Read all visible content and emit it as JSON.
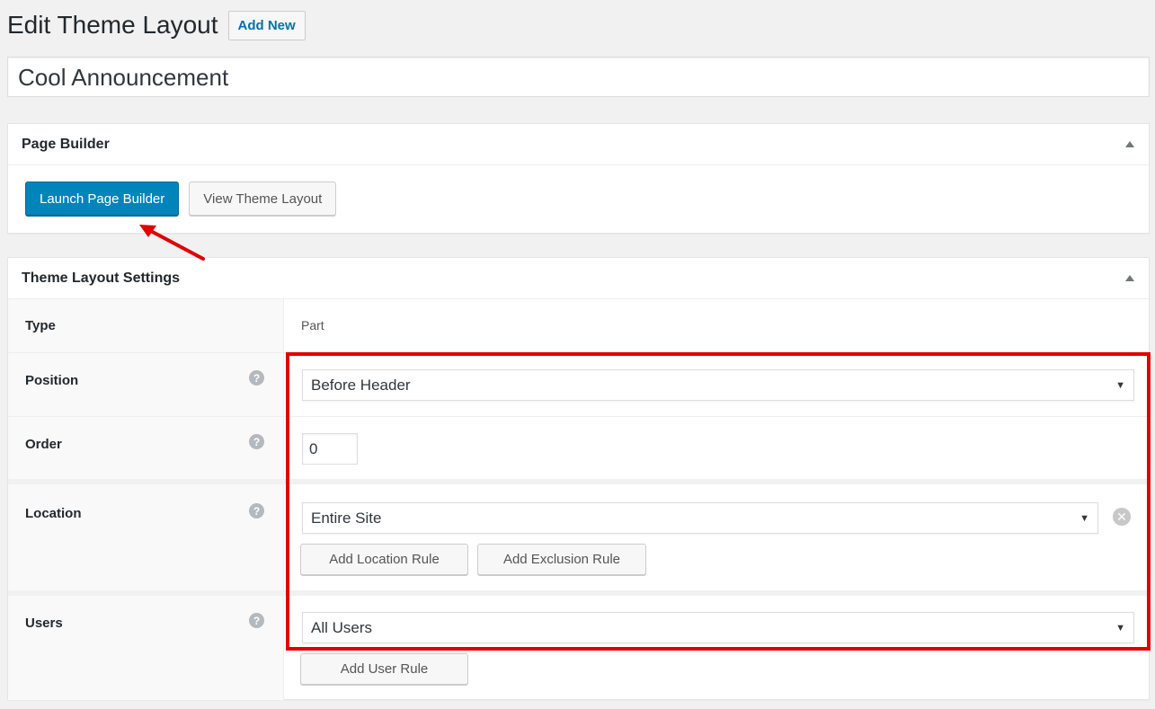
{
  "header": {
    "title": "Edit Theme Layout",
    "add_new_label": "Add New"
  },
  "post_title": "Cool Announcement",
  "page_builder_box": {
    "title": "Page Builder",
    "launch_label": "Launch Page Builder",
    "view_label": "View Theme Layout"
  },
  "settings_box": {
    "title": "Theme Layout Settings",
    "rows": {
      "type": {
        "label": "Type",
        "value": "Part"
      },
      "position": {
        "label": "Position",
        "value": "Before Header"
      },
      "order": {
        "label": "Order",
        "value": "0"
      },
      "location": {
        "label": "Location",
        "value": "Entire Site",
        "add_location_label": "Add Location Rule",
        "add_exclusion_label": "Add Exclusion Rule"
      },
      "users": {
        "label": "Users",
        "value": "All Users",
        "add_user_label": "Add User Rule"
      }
    },
    "help_glyph": "?"
  },
  "icons": {
    "collapse": "triangle-up-icon",
    "help": "question-circle-icon",
    "remove": "close-circle-icon",
    "dropdown": "caret-down-icon"
  },
  "colors": {
    "primary": "#0085ba",
    "link": "#0073aa",
    "annotation": "#e00000"
  }
}
